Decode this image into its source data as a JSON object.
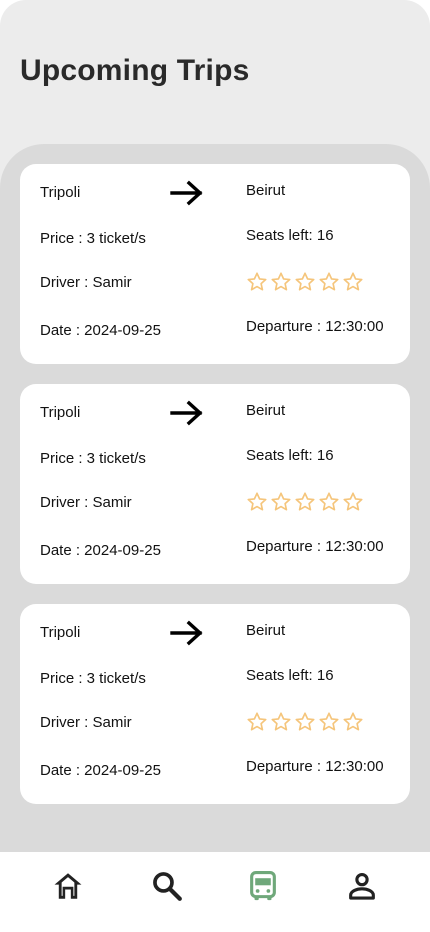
{
  "header": {
    "title": "Upcoming Trips"
  },
  "colors": {
    "star": "#f5c57b",
    "active_nav": "#6fa87a",
    "inactive_nav": "#222222"
  },
  "trips": [
    {
      "from": "Tripoli",
      "to": "Beirut",
      "price": "Price : 3 ticket/s",
      "seats": "Seats left: 16",
      "driver": "Driver : Samir",
      "date": "Date : 2024-09-25",
      "departure": "Departure : 12:30:00",
      "rating": 0,
      "rating_max": 5
    },
    {
      "from": "Tripoli",
      "to": "Beirut",
      "price": "Price : 3 ticket/s",
      "seats": "Seats left: 16",
      "driver": "Driver : Samir",
      "date": "Date : 2024-09-25",
      "departure": "Departure : 12:30:00",
      "rating": 0,
      "rating_max": 5
    },
    {
      "from": "Tripoli",
      "to": "Beirut",
      "price": "Price : 3 ticket/s",
      "seats": "Seats left: 16",
      "driver": "Driver : Samir",
      "date": "Date : 2024-09-25",
      "departure": "Departure : 12:30:00",
      "rating": 0,
      "rating_max": 5
    }
  ],
  "nav": {
    "items": [
      {
        "icon": "home-icon",
        "active": false
      },
      {
        "icon": "search-icon",
        "active": false
      },
      {
        "icon": "bus-icon",
        "active": true
      },
      {
        "icon": "person-icon",
        "active": false
      }
    ]
  }
}
